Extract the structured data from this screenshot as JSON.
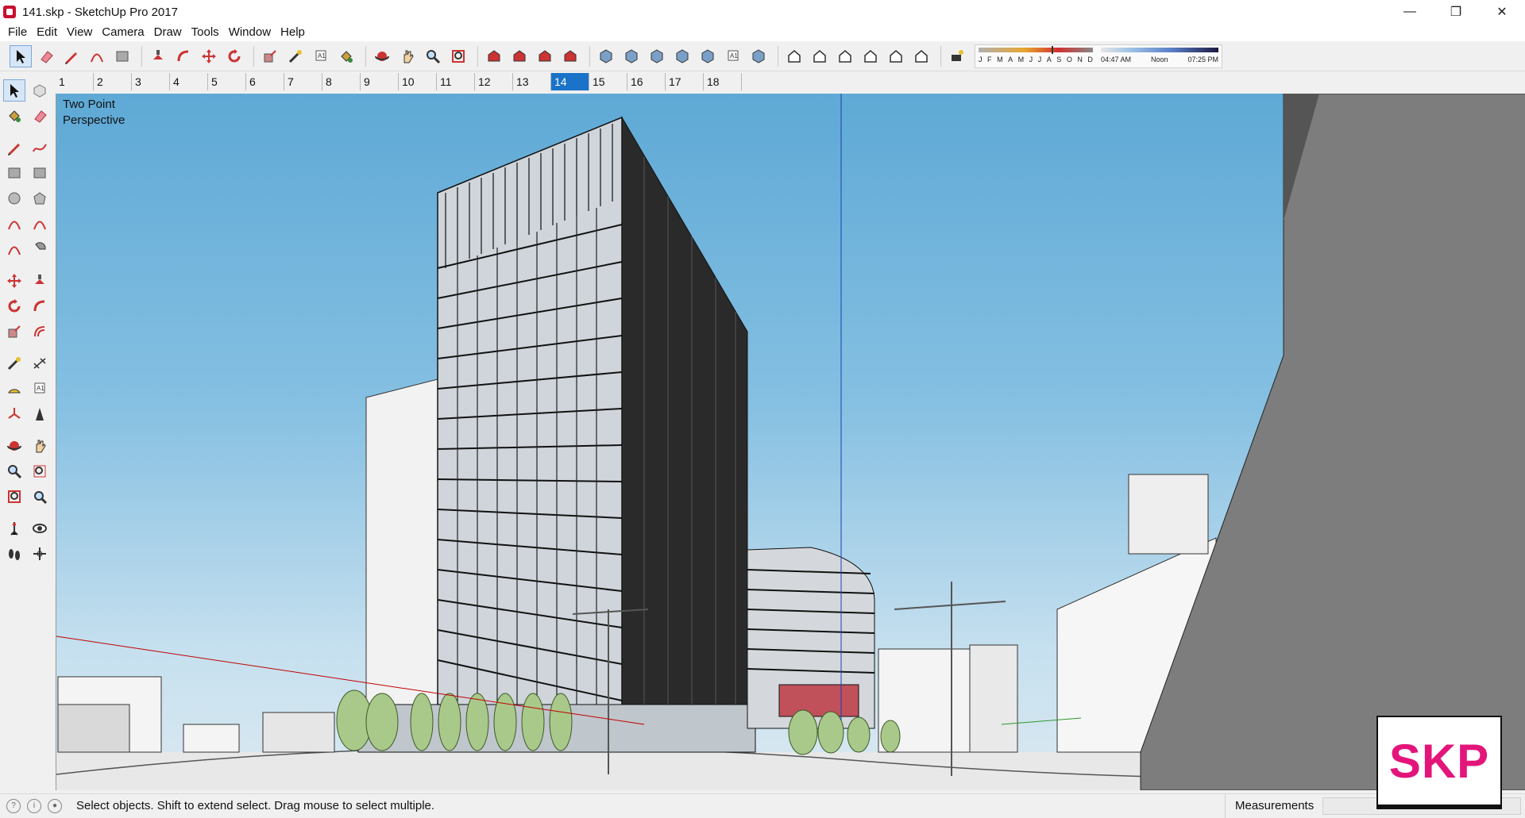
{
  "window": {
    "title": "141.skp - SketchUp Pro 2017",
    "controls": {
      "minimize": "—",
      "restore": "❐",
      "close": "✕"
    }
  },
  "menu": [
    "File",
    "Edit",
    "View",
    "Camera",
    "Draw",
    "Tools",
    "Window",
    "Help"
  ],
  "toolbar": {
    "icons": [
      "select-icon",
      "eraser-icon",
      "pencil-icon",
      "arc-icon",
      "rectangle-icon",
      "push-pull-icon",
      "follow-me-icon",
      "move-icon",
      "rotate-icon",
      "scale-icon",
      "tape-measure-icon",
      "text-icon",
      "paint-bucket-icon",
      "orbit-icon",
      "pan-icon",
      "zoom-icon",
      "zoom-extents-icon",
      "3d-warehouse-icon",
      "extension-warehouse-icon",
      "layout-icon",
      "ruby-icon",
      "xray-icon",
      "back-edges-icon",
      "wireframe-icon",
      "hidden-line-icon",
      "shaded-icon",
      "shaded-textures-icon",
      "monochrome-icon",
      "iso-view-icon",
      "top-view-icon",
      "front-view-icon",
      "right-view-icon",
      "back-view-icon",
      "left-view-icon",
      "shadows-icon"
    ],
    "shadow_months": [
      "J",
      "F",
      "M",
      "A",
      "M",
      "J",
      "J",
      "A",
      "S",
      "O",
      "N",
      "D"
    ],
    "shadow_times": [
      "04:47 AM",
      "Noon",
      "07:25 PM"
    ]
  },
  "scenes": {
    "tabs": [
      "1",
      "2",
      "3",
      "4",
      "5",
      "6",
      "7",
      "8",
      "9",
      "10",
      "11",
      "12",
      "13",
      "14",
      "15",
      "16",
      "17",
      "18"
    ],
    "active": "14"
  },
  "tool_palette": {
    "rows": [
      [
        "select-tool-icon",
        "component-icon"
      ],
      [
        "paint-bucket-tool-icon",
        "eraser-tool-icon"
      ],
      [
        "line-tool-icon",
        "freehand-tool-icon"
      ],
      [
        "rectangle-tool-icon",
        "rotated-rectangle-icon"
      ],
      [
        "circle-tool-icon",
        "polygon-tool-icon"
      ],
      [
        "arc-tool-icon",
        "two-point-arc-icon"
      ],
      [
        "three-point-arc-icon",
        "pie-tool-icon"
      ],
      [
        "move-tool-icon",
        "push-pull-tool-icon"
      ],
      [
        "rotate-tool-icon",
        "follow-me-tool-icon"
      ],
      [
        "scale-tool-icon",
        "offset-tool-icon"
      ],
      [
        "tape-measure-tool-icon",
        "dimension-tool-icon"
      ],
      [
        "protractor-tool-icon",
        "text-tool-icon"
      ],
      [
        "axes-tool-icon",
        "3d-text-icon"
      ],
      [
        "orbit-tool-icon",
        "pan-tool-icon"
      ],
      [
        "zoom-tool-icon",
        "zoom-window-icon"
      ],
      [
        "zoom-extents-tool-icon",
        "previous-view-icon"
      ],
      [
        "position-camera-icon",
        "look-around-icon"
      ],
      [
        "walk-tool-icon",
        "section-plane-icon"
      ]
    ]
  },
  "viewport": {
    "label": "Two Point\nPerspective"
  },
  "status": {
    "message": "Select objects. Shift to extend select. Drag mouse to select multiple.",
    "measurements_label": "Measurements",
    "measurements_value": ""
  },
  "badge": {
    "text": "SKP",
    "color": "#e3157a"
  },
  "colors": {
    "sky_top": "#5ea9d6",
    "accent": "#1a73c8",
    "axis_red": "#c00000",
    "axis_blue": "#1a3fb0",
    "axis_green": "#2a9a2a"
  }
}
